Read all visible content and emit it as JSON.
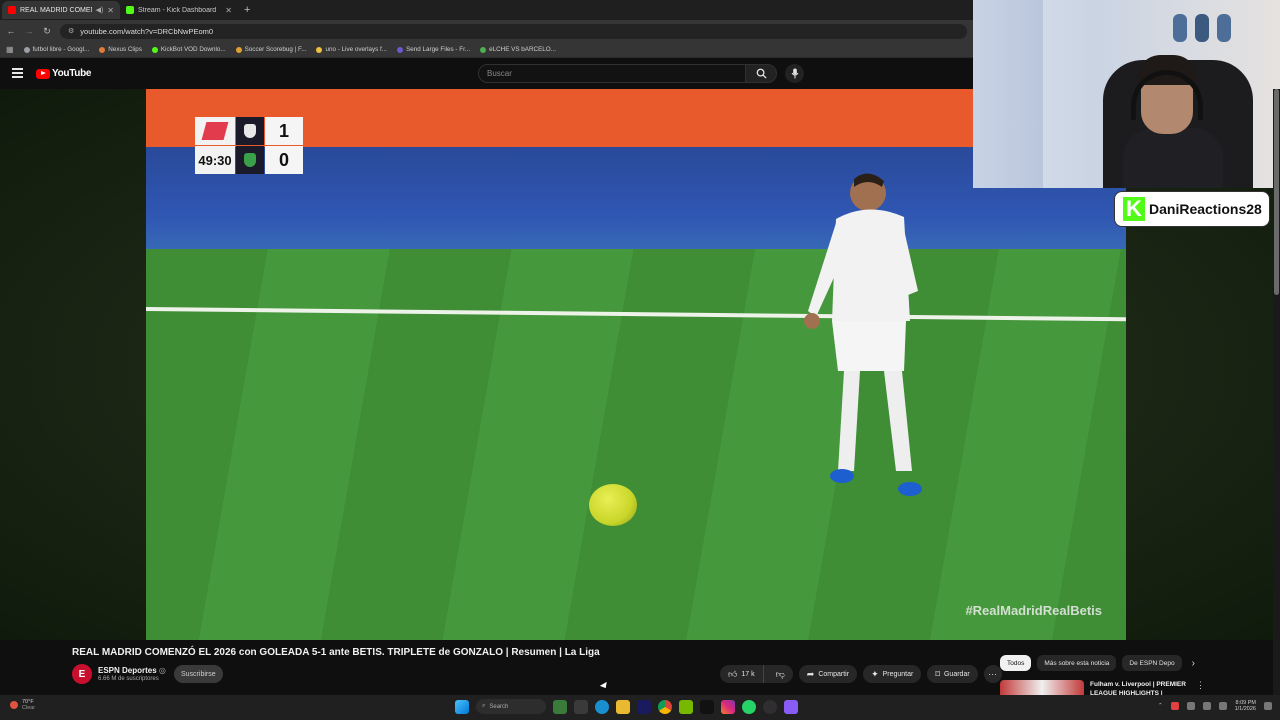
{
  "browser": {
    "tabs": [
      {
        "label": "REAL MADRID COMENZÓ",
        "favicon_color": "#ff0000",
        "active": true
      },
      {
        "label": "Stream - Kick Dashboard",
        "favicon_color": "#53fc18",
        "active": false
      }
    ],
    "new_tab": "+",
    "url": "youtube.com/watch?v=DRCbNwPEom0",
    "bookmarks": [
      {
        "label": "futbol libre - Googl...",
        "color": "#9aa0a6"
      },
      {
        "label": "Nexus Clips",
        "color": "#e07b39"
      },
      {
        "label": "KickBot VOD Downlo...",
        "color": "#53fc18"
      },
      {
        "label": "Soccer Scorebug | F...",
        "color": "#e0a030"
      },
      {
        "label": "uno - Live overlays f...",
        "color": "#f0c040"
      },
      {
        "label": "Send Large Files - Fr...",
        "color": "#6a5acd"
      },
      {
        "label": "eLCHE VS bARCELO...",
        "color": "#4caf50"
      }
    ]
  },
  "youtube": {
    "logo_text": "YouTube",
    "search_placeholder": "Buscar"
  },
  "video": {
    "scorebug": {
      "clock": "49:30",
      "home_score": "1",
      "away_score": "0"
    },
    "hashtag": "#RealMadridRealBetis",
    "title": "REAL MADRID COMENZÓ EL 2026 con GOLEADA 5-1 ante BETIS. TRIPLETE de GONZALO | Resumen | La Liga",
    "channel_name": "ESPN Deportes",
    "verified": "◎",
    "subscribers": "6.66 M de suscriptores",
    "subscribe_label": "Suscribirse",
    "actions": {
      "likes": "17 k",
      "share": "Compartir",
      "ask": "Preguntar",
      "save": "Guardar",
      "more": "···"
    }
  },
  "stream_overlay": {
    "kick_username": "DaniReactions28"
  },
  "sidebar": {
    "chips": [
      "Todos",
      "Más sobre esta noticia",
      "De ESPN Depo"
    ],
    "recommendation_title": "Fulham v. Liverpool | PREMIER LEAGUE HIGHLIGHTS |"
  },
  "taskbar": {
    "weather_temp": "70°F",
    "weather_desc": "Clear",
    "search_label": "Search",
    "time": "8:09 PM",
    "date": "1/1/2026"
  }
}
